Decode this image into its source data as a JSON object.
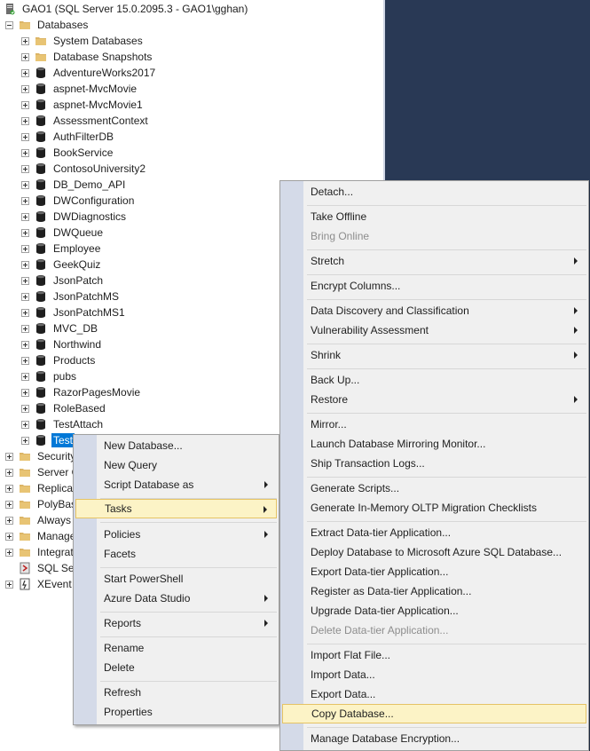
{
  "explorer": {
    "server_label": "GAO1 (SQL Server 15.0.2095.3 - GAO1\\gghan)",
    "databases_label": "Databases",
    "system_databases": "System Databases",
    "database_snapshots": "Database Snapshots",
    "databases": [
      "AdventureWorks2017",
      "aspnet-MvcMovie",
      "aspnet-MvcMovie1",
      "AssessmentContext",
      "AuthFilterDB",
      "BookService",
      "ContosoUniversity2",
      "DB_Demo_API",
      "DWConfiguration",
      "DWDiagnostics",
      "DWQueue",
      "Employee",
      "GeekQuiz",
      "JsonPatch",
      "JsonPatchMS",
      "JsonPatchMS1",
      "MVC_DB",
      "Northwind",
      "Products",
      "pubs",
      "RazorPagesMovie",
      "RoleBased",
      "TestAttach"
    ],
    "selected_database": "Test",
    "server_nodes": [
      "Security",
      "Server O",
      "Replicat",
      "PolyBas",
      "Always",
      "Manage",
      "Integrat",
      "SQL Ser",
      "XEvent"
    ]
  },
  "context_menu": {
    "items": [
      "New Database...",
      "New Query",
      "Script Database as",
      "Tasks",
      "Policies",
      "Facets",
      "Start PowerShell",
      "Azure Data Studio",
      "Reports",
      "Rename",
      "Delete",
      "Refresh",
      "Properties"
    ]
  },
  "tasks_menu": {
    "items": [
      "Detach...",
      "Take Offline",
      "Bring Online",
      "Stretch",
      "Encrypt Columns...",
      "Data Discovery and Classification",
      "Vulnerability Assessment",
      "Shrink",
      "Back Up...",
      "Restore",
      "Mirror...",
      "Launch Database Mirroring Monitor...",
      "Ship Transaction Logs...",
      "Generate Scripts...",
      "Generate In-Memory OLTP Migration Checklists",
      "Extract Data-tier Application...",
      "Deploy Database to Microsoft Azure SQL Database...",
      "Export Data-tier Application...",
      "Register as Data-tier Application...",
      "Upgrade Data-tier Application...",
      "Delete Data-tier Application...",
      "Import Flat File...",
      "Import Data...",
      "Export Data...",
      "Copy Database...",
      "Manage Database Encryption..."
    ]
  },
  "colors": {
    "selection": "#0078d7",
    "menu_highlight": "#fcf3c6",
    "menu_highlight_border": "#e5c365",
    "background_right": "#293955"
  }
}
